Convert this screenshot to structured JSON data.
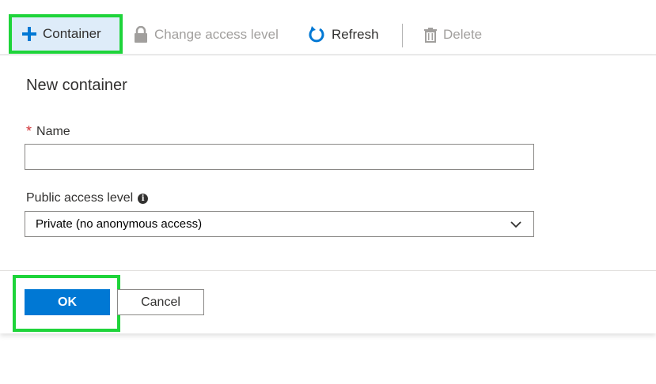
{
  "toolbar": {
    "container_label": "Container",
    "change_access_label": "Change access level",
    "refresh_label": "Refresh",
    "delete_label": "Delete",
    "container_icon": "plus-icon",
    "change_access_icon": "lock-icon",
    "refresh_icon": "refresh-icon",
    "delete_icon": "trash-icon"
  },
  "panel": {
    "title": "New container",
    "name_required_mark": "*",
    "name_label": "Name",
    "name_value": "",
    "public_access_label": "Public access level",
    "info_icon": "info-icon",
    "public_access_selected": "Private (no anonymous access)",
    "ok_label": "OK",
    "cancel_label": "Cancel"
  },
  "colors": {
    "accent": "#0078d4",
    "highlight": "#1ed43a",
    "required": "#d13438",
    "disabled_text": "#a19f9d"
  }
}
